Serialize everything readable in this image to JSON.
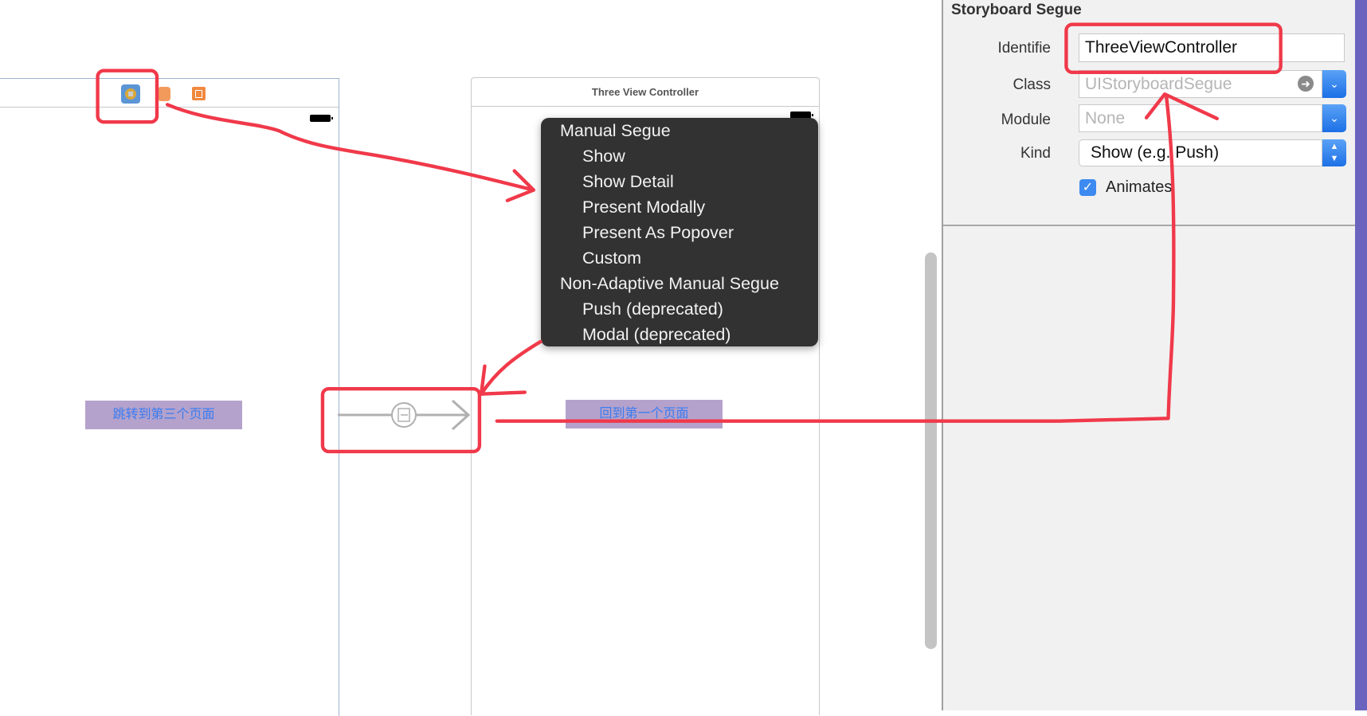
{
  "canvas": {
    "left_scene": {
      "dock_icons": [
        "view-controller-icon",
        "first-responder-icon",
        "exit-icon"
      ],
      "button_label": "跳转到第三个页面"
    },
    "segue_icon": "segue-arrow-icon",
    "right_scene": {
      "title": "Three View Controller",
      "button_label": "回到第一个页面"
    }
  },
  "segue_menu": {
    "groups": [
      {
        "header": "Manual Segue",
        "items": [
          "Show",
          "Show Detail",
          "Present Modally",
          "Present As Popover",
          "Custom"
        ]
      },
      {
        "header": "Non-Adaptive Manual Segue",
        "items": [
          "Push (deprecated)",
          "Modal (deprecated)"
        ]
      }
    ]
  },
  "inspector": {
    "section_title": "Storyboard Segue",
    "identifier": {
      "label": "Identifie",
      "value": "ThreeViewController"
    },
    "class": {
      "label": "Class",
      "placeholder": "UIStoryboardSegue"
    },
    "module": {
      "label": "Module",
      "placeholder": "None"
    },
    "kind": {
      "label": "Kind",
      "value": "Show (e.g. Push)"
    },
    "animates": {
      "label": "Animates",
      "checked": true
    }
  },
  "colors": {
    "annotation": "#f0394a",
    "accent": "#2f7fef",
    "button_bg": "#b4a2cc",
    "menu_bg": "#323232"
  }
}
